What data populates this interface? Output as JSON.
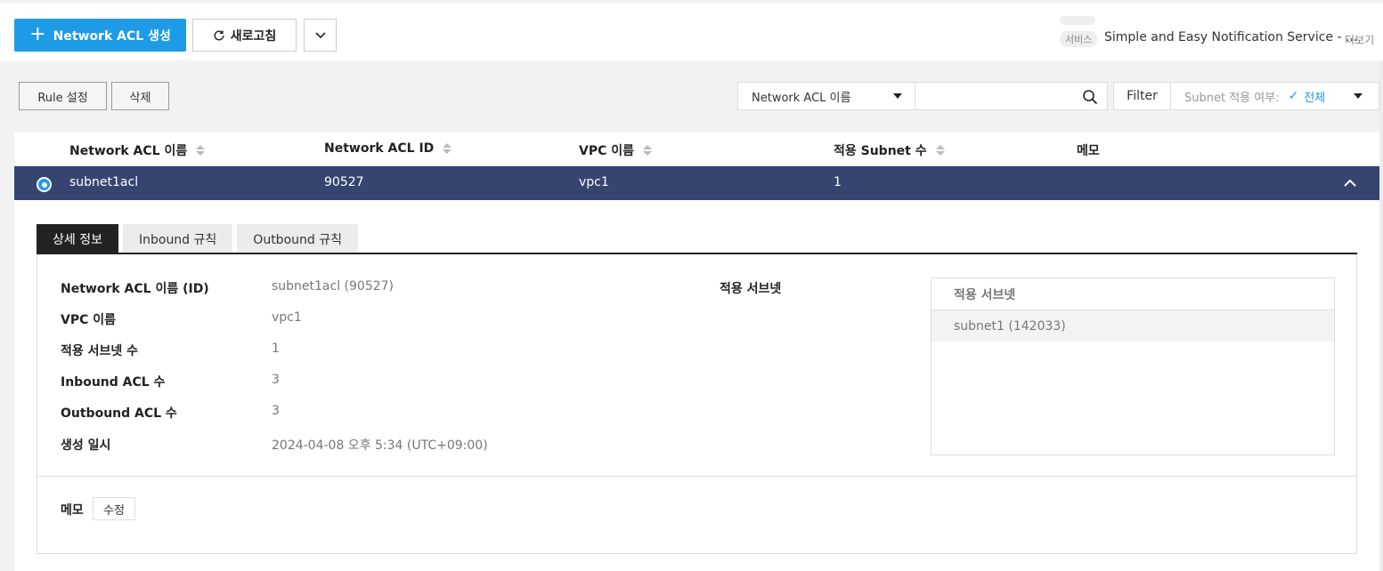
{
  "toolbar": {
    "create_label": "Network ACL 생성",
    "refresh_label": "새로고침"
  },
  "notice": {
    "badge": "서비스",
    "text": "Simple and Easy Notification Service - ...",
    "more": "더보기"
  },
  "actions": {
    "rule_label": "Rule 설정",
    "delete_label": "삭제"
  },
  "search": {
    "field_selected": "Network ACL 이름",
    "value": "",
    "filter_label": "Filter",
    "subnet_filter_label": "Subnet 적용 여부:",
    "subnet_filter_value": "전체"
  },
  "table": {
    "columns": [
      "Network ACL 이름",
      "Network ACL ID",
      "VPC 이름",
      "적용 Subnet 수",
      "메모"
    ],
    "rows": [
      {
        "name": "subnet1acl",
        "id": "90527",
        "vpc": "vpc1",
        "subnet_count": "1",
        "memo": ""
      }
    ]
  },
  "detail": {
    "tabs": [
      "상세 정보",
      "Inbound 규칙",
      "Outbound 규칙"
    ],
    "active_tab": "상세 정보",
    "fields": [
      {
        "label": "Network ACL 이름 (ID)",
        "value": "subnet1acl (90527)"
      },
      {
        "label": "VPC 이름",
        "value": "vpc1"
      },
      {
        "label": "적용 서브넷 수",
        "value": "1"
      },
      {
        "label": "Inbound ACL 수",
        "value": "3"
      },
      {
        "label": "Outbound ACL 수",
        "value": "3"
      },
      {
        "label": "생성 일시",
        "value": "2024-04-08 오후 5:34 (UTC+09:00)"
      }
    ],
    "applied_subnets_label": "적용 서브넷",
    "applied_subnets_header": "적용 서브넷",
    "applied_subnets": [
      "subnet1 (142033)"
    ],
    "memo_label": "메모",
    "memo_edit_label": "수정"
  },
  "colors": {
    "primary": "#1e9be6",
    "selected_row": "#354570"
  }
}
